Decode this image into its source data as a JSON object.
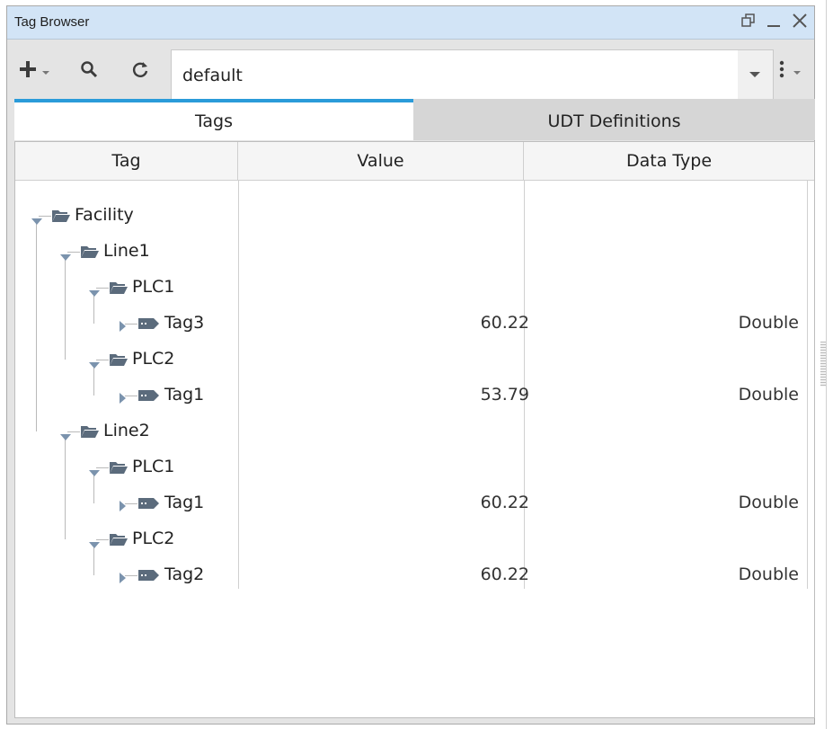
{
  "window": {
    "title": "Tag Browser"
  },
  "toolbar": {
    "provider_value": "default"
  },
  "tabs": [
    {
      "label": "Tags",
      "active": true
    },
    {
      "label": "UDT Definitions",
      "active": false
    }
  ],
  "table": {
    "columns": [
      "Tag",
      "Value",
      "Data Type"
    ],
    "rows": [
      {
        "name": "Facility",
        "value": "",
        "type": ""
      },
      {
        "name": "Line1",
        "value": "",
        "type": ""
      },
      {
        "name": "PLC1",
        "value": "",
        "type": ""
      },
      {
        "name": "Tag3",
        "value": "60.22",
        "type": "Double"
      },
      {
        "name": "PLC2",
        "value": "",
        "type": ""
      },
      {
        "name": "Tag1",
        "value": "53.79",
        "type": "Double"
      },
      {
        "name": "Line2",
        "value": "",
        "type": ""
      },
      {
        "name": "PLC1",
        "value": "",
        "type": ""
      },
      {
        "name": "Tag1",
        "value": "60.22",
        "type": "Double"
      },
      {
        "name": "PLC2",
        "value": "",
        "type": ""
      },
      {
        "name": "Tag2",
        "value": "60.22",
        "type": "Double"
      }
    ]
  },
  "colors": {
    "accent": "#2a9bd9",
    "titlebar": "#d2e4f6",
    "icon": "#5b6b7c"
  }
}
